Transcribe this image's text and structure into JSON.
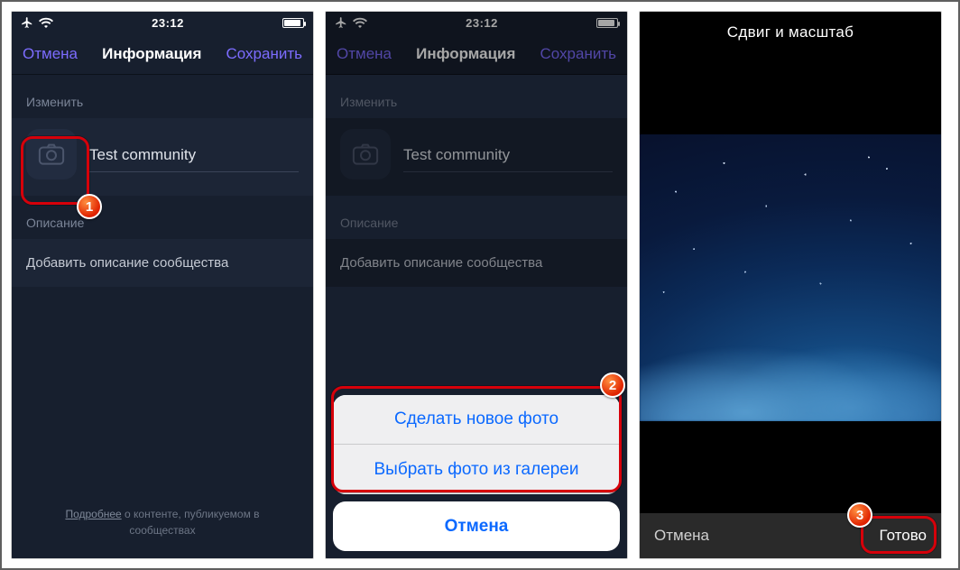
{
  "status": {
    "time": "23:12"
  },
  "nav": {
    "cancel": "Отмена",
    "title": "Информация",
    "save": "Сохранить"
  },
  "edit": {
    "section_edit": "Изменить",
    "community_name": "Test community",
    "section_desc": "Описание",
    "desc_placeholder": "Добавить описание сообщества"
  },
  "footer": {
    "more": "Подробнее",
    "rest": " о контенте, публикуемом в сообществах"
  },
  "sheet": {
    "take_photo": "Сделать новое фото",
    "choose_photo": "Выбрать фото из галереи",
    "cancel": "Отмена"
  },
  "crop": {
    "title": "Сдвиг и масштаб",
    "cancel": "Отмена",
    "done": "Готово"
  },
  "badges": {
    "one": "1",
    "two": "2",
    "three": "3"
  }
}
